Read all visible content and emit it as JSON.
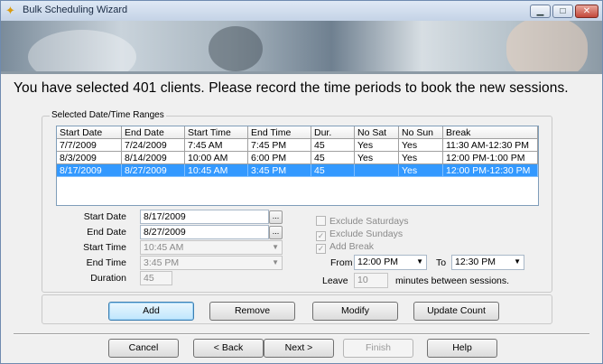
{
  "window": {
    "title": "Bulk Scheduling Wizard",
    "icon": "wand-star-icon",
    "controls": {
      "minimize": "▁",
      "maximize": "□",
      "close": "✕"
    }
  },
  "headline": "You have selected 401 clients.  Please record the time periods to book the new sessions.",
  "ranges": {
    "group_label": "Selected Date/Time Ranges",
    "columns": [
      "Start Date",
      "End Date",
      "Start Time",
      "End Time",
      "Dur.",
      "No Sat",
      "No Sun",
      "Break"
    ],
    "rows": [
      [
        "7/7/2009",
        "7/24/2009",
        "7:45 AM",
        "7:45 PM",
        "45",
        "Yes",
        "Yes",
        "11:30 AM-12:30 PM"
      ],
      [
        "8/3/2009",
        "8/14/2009",
        "10:00 AM",
        "6:00 PM",
        "45",
        "Yes",
        "Yes",
        "12:00 PM-1:00 PM"
      ],
      [
        "8/17/2009",
        "8/27/2009",
        "10:45 AM",
        "3:45 PM",
        "45",
        "",
        "Yes",
        "12:00 PM-12:30 PM"
      ]
    ],
    "selected_row": 2
  },
  "form": {
    "start_date": {
      "label": "Start Date",
      "value": "8/17/2009"
    },
    "end_date": {
      "label": "End Date",
      "value": "8/27/2009"
    },
    "start_time": {
      "label": "Start Time",
      "value": "10:45 AM"
    },
    "end_time": {
      "label": "End Time",
      "value": "3:45 PM"
    },
    "duration": {
      "label": "Duration",
      "value": "45"
    },
    "dots": "...",
    "exclude_saturdays": {
      "label": "Exclude Saturdays",
      "checked": false
    },
    "exclude_sundays": {
      "label": "Exclude Sundays",
      "checked": true
    },
    "add_break": {
      "label": "Add Break",
      "checked": true
    },
    "break_from": {
      "label": "From",
      "value": "12:00 PM"
    },
    "break_to": {
      "label": "To",
      "value": "12:30 PM"
    },
    "leave": {
      "label": "Leave",
      "value": "10",
      "suffix": "minutes between sessions."
    }
  },
  "actions": {
    "add": "Add",
    "remove": "Remove",
    "modify": "Modify",
    "update_count": "Update Count"
  },
  "nav": {
    "cancel": "Cancel",
    "back": "< Back",
    "next": "Next >",
    "finish": "Finish",
    "help": "Help"
  }
}
